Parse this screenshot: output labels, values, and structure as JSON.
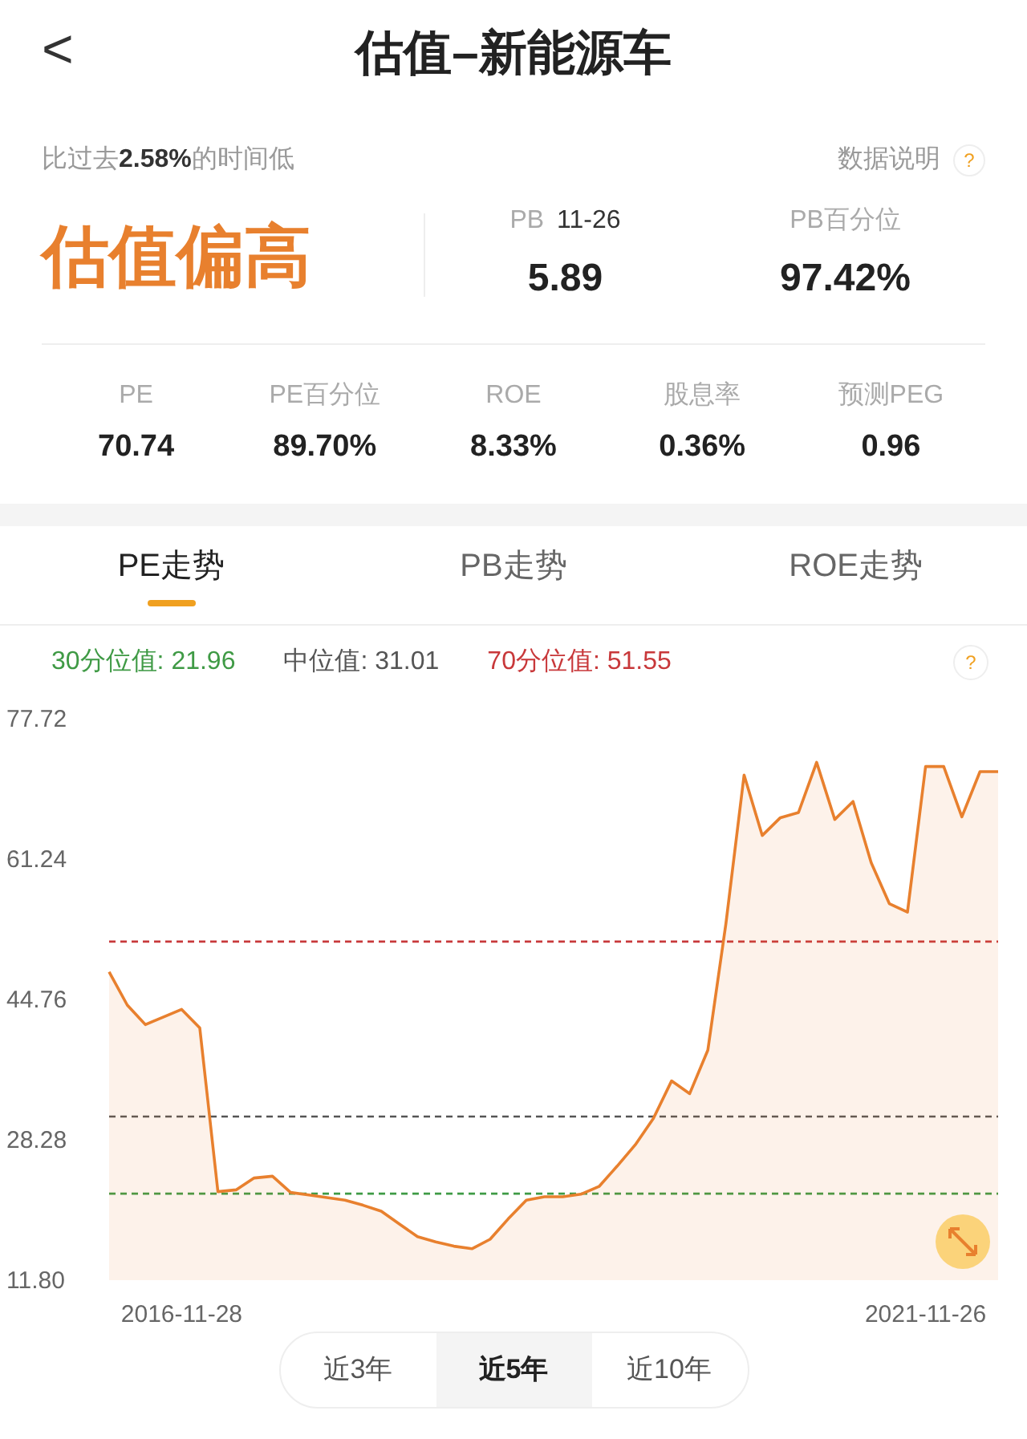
{
  "header": {
    "back": "<",
    "title": "估值–新能源车"
  },
  "summary": {
    "note": "比过去**2.58%**的时间低",
    "help_label": "数据说明",
    "help_icon": "?",
    "verdict": "估值偏高",
    "pb_label": "PB",
    "pb_date": "11-26",
    "pb_value": "5.89",
    "pb_pct_label": "PB百分位",
    "pb_pct_value": "97.42%"
  },
  "metrics": [
    {
      "label": "PE",
      "value": "70.74"
    },
    {
      "label": "PE百分位",
      "value": "89.70%"
    },
    {
      "label": "ROE",
      "value": "8.33%"
    },
    {
      "label": "股息率",
      "value": "0.36%"
    },
    {
      "label": "预测PEG",
      "value": "0.96"
    }
  ],
  "tabs": [
    {
      "label": "PE走势",
      "selected": true
    },
    {
      "label": "PB走势",
      "selected": false
    },
    {
      "label": "ROE走势",
      "selected": false
    }
  ],
  "legend_help": "?",
  "chart": {
    "chart_data": {
      "type": "area",
      "categories": [
        null,
        null,
        null,
        null,
        "2016-11-28",
        null,
        null,
        null,
        null,
        null,
        null,
        null,
        null,
        null,
        null,
        null,
        null,
        null,
        null,
        null,
        null,
        null,
        null,
        null,
        null,
        null,
        null,
        null,
        null,
        null,
        null,
        null,
        null,
        null,
        null,
        null,
        null,
        null,
        null,
        null,
        null,
        null,
        null,
        null,
        null,
        "2021-11-26",
        null,
        null,
        null,
        null
      ],
      "series": [
        {
          "color": "#e8802e",
          "values": [
            48.0,
            44.1,
            41.8,
            42.7,
            43.6,
            41.4,
            22.2,
            22.4,
            23.8,
            24.0,
            22.1,
            21.8,
            21.5,
            21.2,
            20.6,
            19.9,
            18.4,
            16.9,
            16.3,
            15.8,
            15.5,
            16.6,
            19.0,
            21.2,
            21.6,
            21.6,
            21.9,
            22.8,
            25.2,
            27.7,
            30.8,
            35.2,
            33.7,
            38.8,
            53.7,
            71.1,
            64.0,
            66.1,
            66.7,
            72.6,
            65.9,
            68.0,
            60.8,
            56.0,
            55.0,
            72.1,
            72.1,
            66.2,
            71.5,
            71.5
          ]
        }
      ],
      "ylim": [
        11.8,
        77.72
      ],
      "yticks": [
        {
          "value": 77.72,
          "label": "77.72"
        },
        {
          "value": 61.24,
          "label": "61.24"
        },
        {
          "value": 44.76,
          "label": "44.76"
        },
        {
          "value": 28.28,
          "label": "28.28"
        },
        {
          "value": 11.8,
          "label": "11.80"
        }
      ],
      "ref_lines": [
        {
          "axis": "y",
          "value": 21.96,
          "label": "30分位值: 21.96",
          "color": "#3f9a45"
        },
        {
          "axis": "y",
          "value": 31.01,
          "label": "中位值: 31.01",
          "color": "#555555"
        },
        {
          "axis": "y",
          "value": 51.55,
          "label": "70分位值: 51.55",
          "color": "#c8383a"
        }
      ]
    }
  },
  "ranges": [
    {
      "label": "近3年",
      "selected": false
    },
    {
      "label": "近5年",
      "selected": true
    },
    {
      "label": "近10年",
      "selected": false
    }
  ]
}
